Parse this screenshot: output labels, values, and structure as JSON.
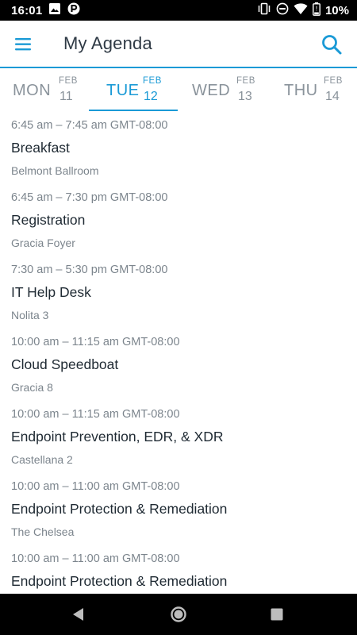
{
  "status_bar": {
    "time": "16:01",
    "battery": "10%",
    "left_icons": [
      "image-icon",
      "parking-app-icon"
    ],
    "right_icons": [
      "vibrate-icon",
      "do-not-disturb-icon",
      "wifi-icon",
      "battery-low-icon"
    ]
  },
  "header": {
    "title": "My Agenda",
    "accent_color": "#1a9ad6"
  },
  "days": [
    {
      "dow": "MON",
      "month": "FEB",
      "day": "11",
      "active": false
    },
    {
      "dow": "TUE",
      "month": "FEB",
      "day": "12",
      "active": true
    },
    {
      "dow": "WED",
      "month": "FEB",
      "day": "13",
      "active": false
    },
    {
      "dow": "THU",
      "month": "FEB",
      "day": "14",
      "active": false
    }
  ],
  "sessions": [
    {
      "time": "6:45 am – 7:45 am GMT-08:00",
      "title": "Breakfast",
      "room": "Belmont Ballroom"
    },
    {
      "time": "6:45 am – 7:30 pm GMT-08:00",
      "title": "Registration",
      "room": "Gracia Foyer"
    },
    {
      "time": "7:30 am – 5:30 pm GMT-08:00",
      "title": "IT Help Desk",
      "room": "Nolita 3"
    },
    {
      "time": "10:00 am – 11:15 am GMT-08:00",
      "title": "Cloud Speedboat",
      "room": "Gracia 8"
    },
    {
      "time": "10:00 am – 11:15 am GMT-08:00",
      "title": "Endpoint Prevention, EDR, & XDR",
      "room": "Castellana 2"
    },
    {
      "time": "10:00 am – 11:00 am GMT-08:00",
      "title": "Endpoint Protection & Remediation",
      "room": "The Chelsea"
    },
    {
      "time": "10:00 am – 11:00 am GMT-08:00",
      "title": "Endpoint Protection & Remediation",
      "room": ""
    }
  ],
  "nav_bar": {
    "icons": [
      "back-icon",
      "home-icon",
      "recents-icon"
    ]
  }
}
